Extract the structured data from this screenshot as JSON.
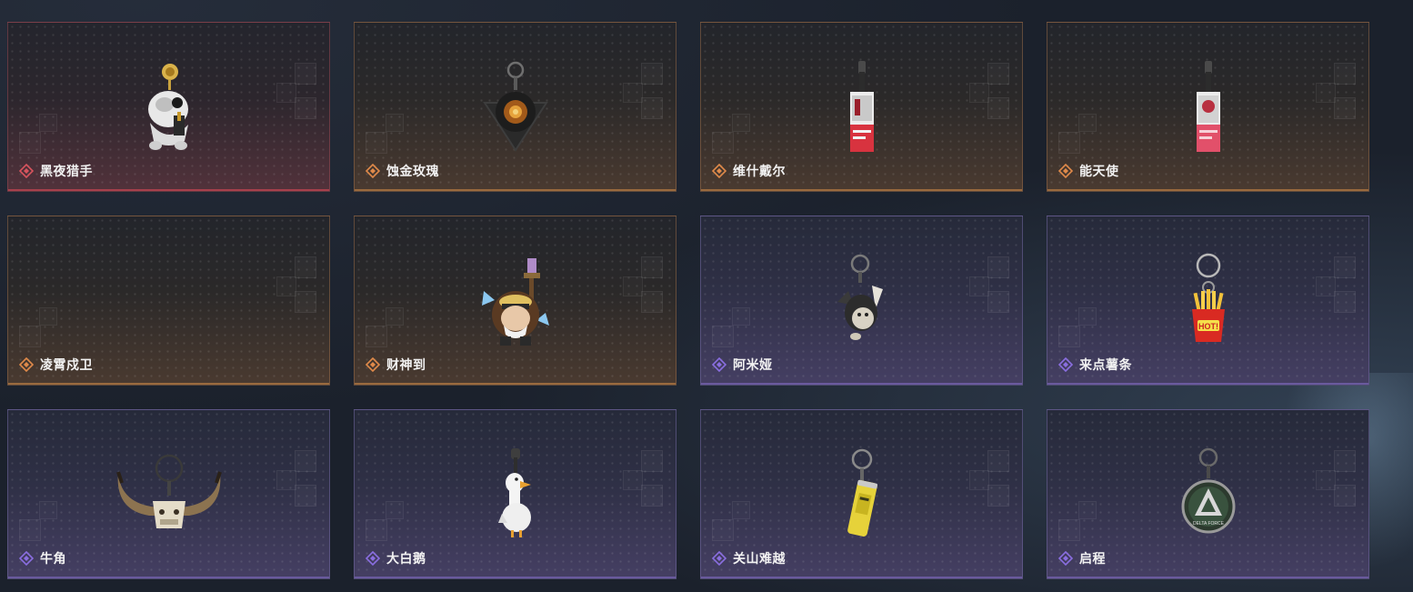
{
  "colors": {
    "red": "#d8545e",
    "orange": "#e08a4a",
    "purple": "#8a6ee0"
  },
  "items": [
    {
      "name": "黑夜猎手",
      "rarity": "red",
      "icon": "white-beast-gold-rose-charm-icon"
    },
    {
      "name": "蚀金玫瑰",
      "rarity": "orange",
      "icon": "gold-rose-pendant-icon"
    },
    {
      "name": "维什戴尔",
      "rarity": "orange",
      "icon": "ticket-tag-red-charm-icon"
    },
    {
      "name": "能天使",
      "rarity": "orange",
      "icon": "ticket-tag-pink-charm-icon"
    },
    {
      "name": "凌霄戍卫",
      "rarity": "orange",
      "icon": "empty-charm-icon"
    },
    {
      "name": "财神到",
      "rarity": "orange",
      "icon": "fortune-god-figure-icon"
    },
    {
      "name": "阿米娅",
      "rarity": "purple",
      "icon": "bunny-keychain-icon"
    },
    {
      "name": "来点薯条",
      "rarity": "purple",
      "icon": "french-fries-keychain-icon"
    },
    {
      "name": "牛角",
      "rarity": "purple",
      "icon": "bull-horns-keychain-icon"
    },
    {
      "name": "大白鹅",
      "rarity": "purple",
      "icon": "white-goose-keychain-icon"
    },
    {
      "name": "关山难越",
      "rarity": "purple",
      "icon": "yellow-can-keychain-icon"
    },
    {
      "name": "启程",
      "rarity": "purple",
      "icon": "round-badge-keychain-icon"
    }
  ],
  "charm_text": {
    "fries_label": "HOT!",
    "badge_label": "DELTA FORCE"
  }
}
